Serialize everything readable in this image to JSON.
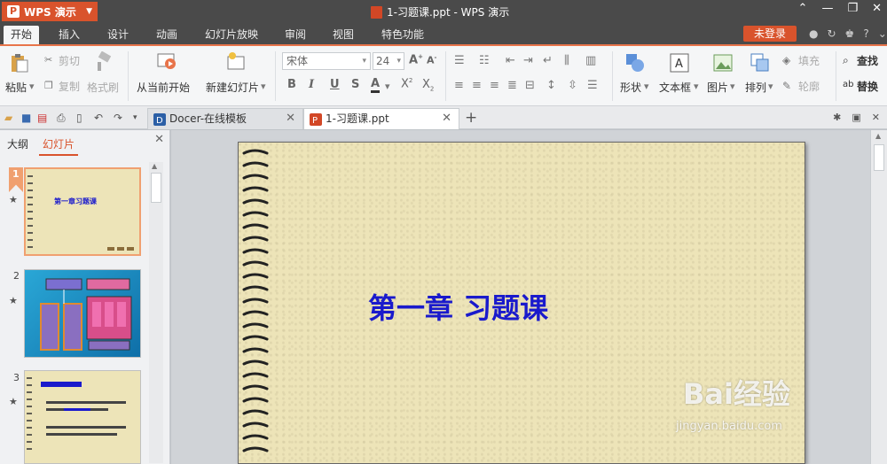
{
  "app": {
    "name": "WPS 演示",
    "logo_letter": "P"
  },
  "window": {
    "title": "1-习题课.ppt - WPS 演示"
  },
  "menu_tabs": [
    "开始",
    "插入",
    "设计",
    "动画",
    "幻灯片放映",
    "审阅",
    "视图",
    "特色功能"
  ],
  "login_label": "未登录",
  "ribbon": {
    "paste": "粘贴",
    "cut": "剪切",
    "copy": "复制",
    "format_painter": "格式刷",
    "from_current": "从当前开始",
    "new_slide": "新建幻灯片",
    "font_name": "宋体",
    "font_size": "24",
    "shape": "形状",
    "textbox": "文本框",
    "picture": "图片",
    "arrange": "排列",
    "fill": "填充",
    "outline": "轮廓",
    "find": "查找",
    "replace": "替换"
  },
  "doc_tabs": [
    {
      "label": "Docer-在线模板"
    },
    {
      "label": "1-习题课.ppt"
    }
  ],
  "left_panel": {
    "tabs": [
      "大纲",
      "幻灯片"
    ],
    "slides": [
      {
        "number": "1",
        "title": "第一章习题课"
      },
      {
        "number": "2"
      },
      {
        "number": "3"
      }
    ]
  },
  "slide": {
    "title": "第一章 习题课"
  },
  "watermark": {
    "brand": "Bai经验",
    "url": "jingyan.baidu.com"
  },
  "colors": {
    "accent": "#d9532c",
    "title_blue": "#1a1acc",
    "slide_bg": "#ede4b8"
  }
}
